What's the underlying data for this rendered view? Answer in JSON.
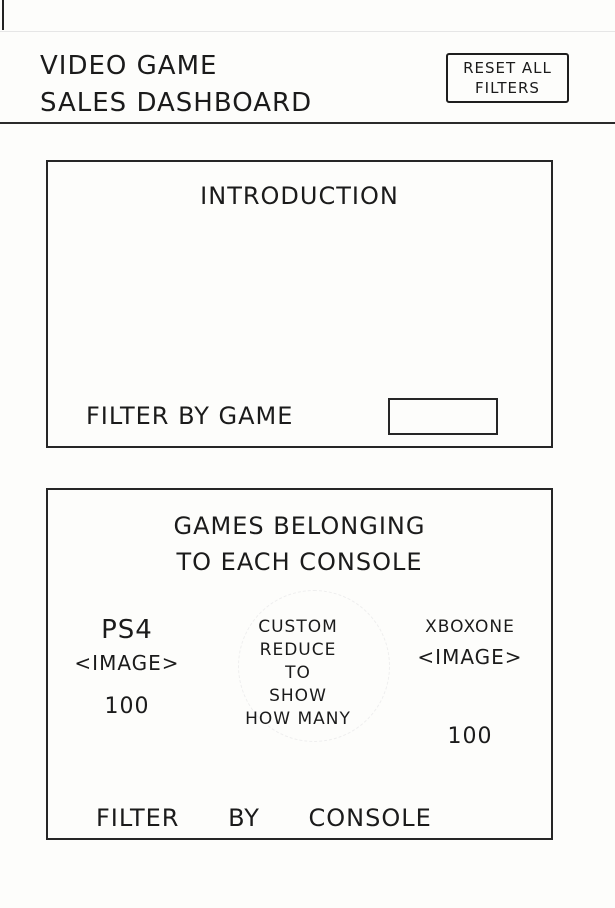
{
  "header": {
    "title_line1": "VIDEO GAME",
    "title_line2": "SALES DASHBOARD",
    "reset_line1": "RESET ALL",
    "reset_line2": "FILTERS"
  },
  "intro": {
    "title": "INTRODUCTION",
    "filter_label": "FILTER BY GAME"
  },
  "console_section": {
    "title_line1": "GAMES BELONGING",
    "title_line2": "TO EACH CONSOLE",
    "ps4": {
      "name": "PS4",
      "image": "<IMAGE>",
      "count": "100"
    },
    "xbox": {
      "name": "XBOXONE",
      "image": "<IMAGE>",
      "count": "100"
    },
    "custom_lines": [
      "CUSTOM",
      "REDUCE",
      "TO",
      "SHOW",
      "HOW MANY"
    ],
    "filter_label": "FILTER BY CONSOLE"
  }
}
